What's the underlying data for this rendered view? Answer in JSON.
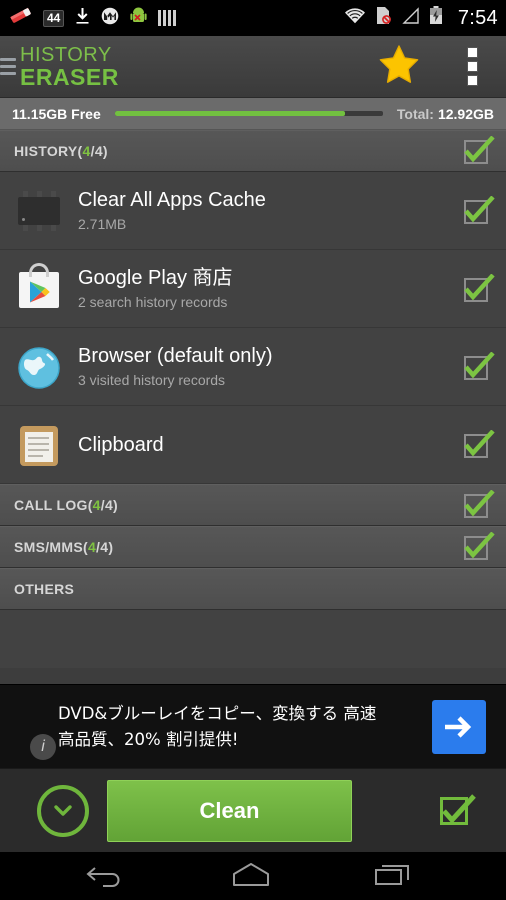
{
  "statusbar": {
    "icons_left": [
      "eraser-icon",
      "notification-count-badge",
      "download-icon",
      "motorola-icon",
      "android-error-icon",
      "signal-bars-icon"
    ],
    "notification_count": "44",
    "icons_right": [
      "wifi-icon",
      "sdcard-disabled-icon",
      "cell-signal-icon",
      "battery-charging-icon"
    ],
    "time": "7:54"
  },
  "header": {
    "logo_line1": "HISTORY",
    "logo_line2": "ERASER",
    "star_icon": "star-icon",
    "overflow_icon": "overflow-menu-icon",
    "drawer_icon": "drawer-icon"
  },
  "storage": {
    "free_label": "11.15GB Free",
    "total_label": "Total:",
    "total_value": "12.92GB",
    "fill_percent": 86,
    "fill_color": "#72c040",
    "track_color": "#3a3a3a"
  },
  "sections": [
    {
      "id": "history",
      "label_main": "HISTORY(",
      "label_count_on": "4",
      "label_rest": "/4)",
      "checked": true,
      "accent_color": "#8cc63f",
      "items": [
        {
          "icon": "memory-chip-icon",
          "title": "Clear All Apps Cache",
          "subtitle": "2.71MB",
          "checked": true
        },
        {
          "icon": "google-play-store-icon",
          "title": "Google Play 商店",
          "subtitle": "2 search history records",
          "checked": true
        },
        {
          "icon": "browser-globe-icon",
          "title": "Browser (default only)",
          "subtitle": "3 visited history records",
          "checked": true
        },
        {
          "icon": "clipboard-icon",
          "title": "Clipboard",
          "subtitle": "",
          "checked": true
        }
      ]
    },
    {
      "id": "call-log",
      "label_main": "CALL LOG(",
      "label_count_on": "4",
      "label_rest": "/4)",
      "checked": true,
      "items": []
    },
    {
      "id": "sms-mms",
      "label_main": "SMS/MMS(",
      "label_count_on": "4",
      "label_rest": "/4)",
      "checked": true,
      "items": []
    },
    {
      "id": "others",
      "label_main": "OTHERS",
      "label_count_on": "",
      "label_rest": "",
      "checked": false,
      "items": []
    }
  ],
  "ad": {
    "line1": "DVD&ブルーレイをコピー、変換する 高速",
    "line2": "高品質、20% 割引提供!",
    "cta_icon": "arrow-right-icon",
    "info_icon": "ad-info-icon",
    "cta_color": "#2b7ced"
  },
  "action_bar": {
    "expand_icon": "chevron-down-circle-icon",
    "clean_label": "Clean",
    "select_all_icon": "checkbox-checked-icon",
    "clean_color": "#72bb3c"
  },
  "navbar": {
    "back_icon": "back-icon",
    "home_icon": "home-icon",
    "recents_icon": "recent-apps-icon"
  }
}
